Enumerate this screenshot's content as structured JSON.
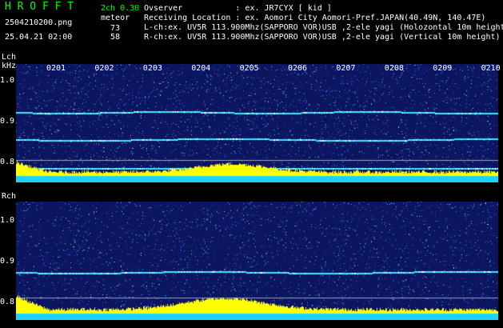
{
  "header": {
    "brand": "H R O F F T",
    "filename": "2504210200.png",
    "datetime": "25.04.21 02:00",
    "channel_mode": "2ch 0.30",
    "meteor_label": "meteor",
    "lch_count": "73",
    "rch_count": "58",
    "observer_line": "Ovserver           : ex. JR7CYX [ kid ]",
    "location_line": "Receiving Location : ex. Aomori City Aomori-Pref.JAPAN(40.49N, 140.47E)",
    "lch_line": "L-ch:ex. UV5R 113.900Mhz(SAPPORO VOR)USB ,2-ele yagi (Holozontal 10m height)",
    "rch_line": "R-ch:ex. UV5R 113.900Mhz(SAPPORO VOR)USB ,2-ele yagi (Vertical 10m height)"
  },
  "lch_panel": {
    "label": "Lch",
    "unit": "kHz",
    "y_ticks": [
      "1.0",
      "0.9",
      "0.8"
    ],
    "time_ticks": [
      "0201",
      "0202",
      "0203",
      "0204",
      "0205",
      "0206",
      "0207",
      "0208",
      "0209",
      "0210"
    ]
  },
  "rch_panel": {
    "label": "Rch",
    "y_ticks": [
      "1.0",
      "0.9",
      "0.8"
    ]
  },
  "colors": {
    "background": "#000000",
    "noise_base": "#1a2a8a",
    "trace": "#3cf0ff",
    "activity_bar": "#ffff00",
    "brand_text": "#00ff00"
  }
}
